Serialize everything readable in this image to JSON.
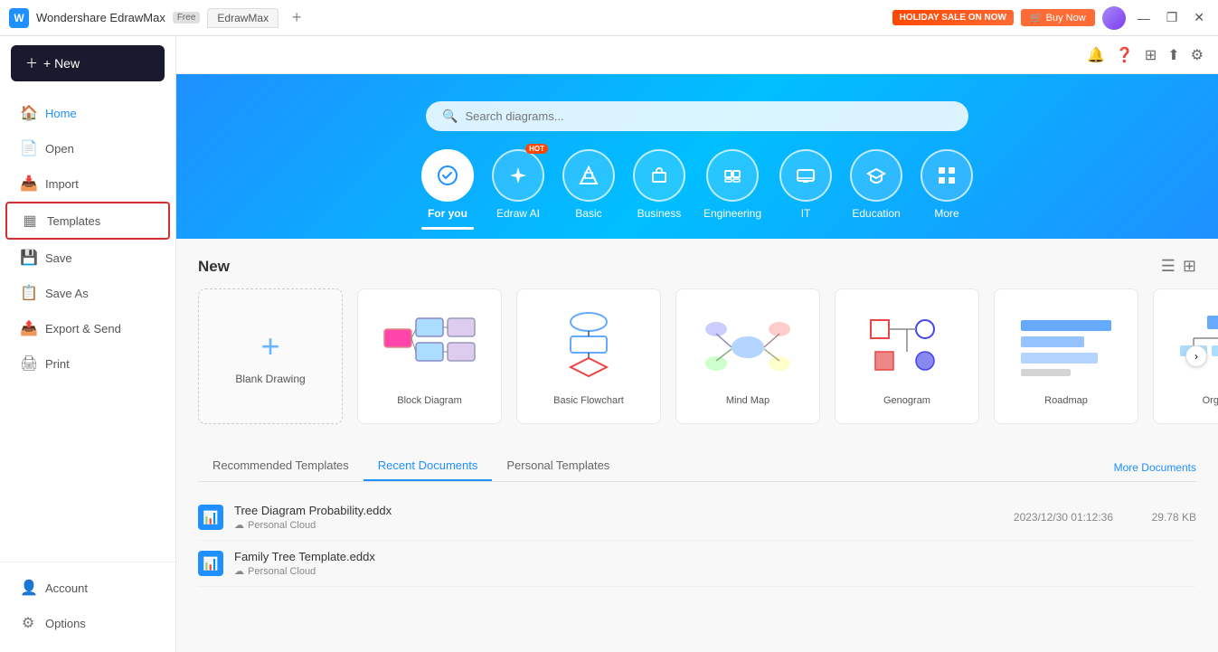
{
  "titlebar": {
    "app_name": "Wondershare EdrawMax",
    "app_badge": "Free",
    "tab_label": "EdrawMax",
    "tab_add_label": "+",
    "holiday_btn": "HOLIDAY SALE ON NOW",
    "buy_btn": "Buy Now",
    "win_minimize": "—",
    "win_restore": "❐",
    "win_close": "✕"
  },
  "topbar": {
    "bell_icon": "🔔",
    "help_icon": "?",
    "community_icon": "⊞",
    "share_icon": "↑",
    "settings_icon": "⚙"
  },
  "sidebar": {
    "new_btn": "+ New",
    "items": [
      {
        "id": "home",
        "label": "Home",
        "icon": "🏠",
        "active": true
      },
      {
        "id": "open",
        "label": "Open",
        "icon": "📄"
      },
      {
        "id": "import",
        "label": "Import",
        "icon": "📥"
      },
      {
        "id": "templates",
        "label": "Templates",
        "icon": "▦",
        "selected": true
      },
      {
        "id": "save",
        "label": "Save",
        "icon": "💾"
      },
      {
        "id": "saveas",
        "label": "Save As",
        "icon": "📋"
      },
      {
        "id": "export",
        "label": "Export & Send",
        "icon": "📤"
      },
      {
        "id": "print",
        "label": "Print",
        "icon": "🖨"
      }
    ],
    "bottom": [
      {
        "id": "account",
        "label": "Account",
        "icon": "👤"
      },
      {
        "id": "options",
        "label": "Options",
        "icon": "⚙"
      }
    ]
  },
  "hero": {
    "search_placeholder": "Search diagrams...",
    "categories": [
      {
        "id": "foryou",
        "label": "For you",
        "icon": "✦",
        "active": true
      },
      {
        "id": "edrawai",
        "label": "Edraw AI",
        "icon": "/",
        "hot": true
      },
      {
        "id": "basic",
        "label": "Basic",
        "icon": "◆"
      },
      {
        "id": "business",
        "label": "Business",
        "icon": "💼"
      },
      {
        "id": "engineering",
        "label": "Engineering",
        "icon": "🏗"
      },
      {
        "id": "it",
        "label": "IT",
        "icon": "⊞"
      },
      {
        "id": "education",
        "label": "Education",
        "icon": "🎓"
      },
      {
        "id": "more",
        "label": "More",
        "icon": "⊞"
      }
    ]
  },
  "new_section": {
    "title": "New",
    "blank": {
      "label": "Blank Drawing",
      "plus": "+"
    },
    "templates": [
      {
        "id": "block",
        "label": "Block Diagram"
      },
      {
        "id": "flowchart",
        "label": "Basic Flowchart"
      },
      {
        "id": "mindmap",
        "label": "Mind Map"
      },
      {
        "id": "genogram",
        "label": "Genogram"
      },
      {
        "id": "roadmap",
        "label": "Roadmap"
      },
      {
        "id": "orgchart",
        "label": "Org Cha..."
      }
    ]
  },
  "bottom_section": {
    "tabs": [
      {
        "id": "recommended",
        "label": "Recommended Templates"
      },
      {
        "id": "recent",
        "label": "Recent Documents",
        "active": true
      },
      {
        "id": "personal",
        "label": "Personal Templates"
      }
    ],
    "more_docs": "More Documents",
    "documents": [
      {
        "name": "Tree Diagram Probability.eddx",
        "sub": "Personal Cloud",
        "sub_icon": "☁",
        "date": "2023/12/30 01:12:36",
        "size": "29.78 KB"
      },
      {
        "name": "Family Tree Template.eddx",
        "sub": "Personal Cloud",
        "sub_icon": "☁",
        "date": "",
        "size": ""
      }
    ]
  }
}
